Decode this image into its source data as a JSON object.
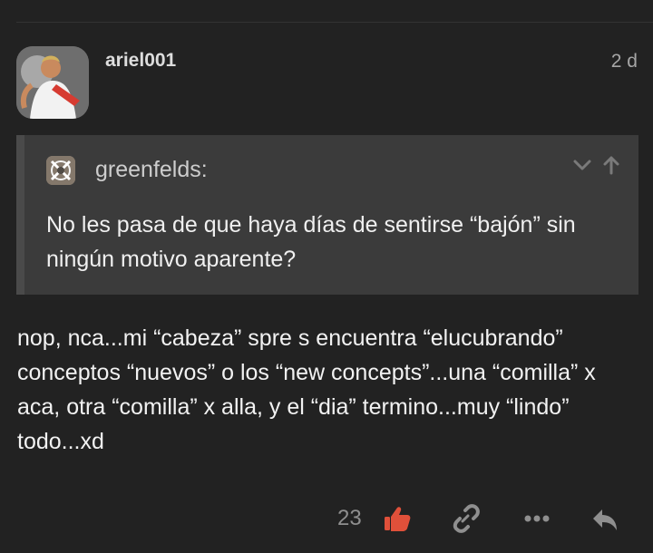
{
  "post": {
    "username": "ariel001",
    "date": "2 d",
    "avatar_icon": "user-avatar-photo",
    "quote": {
      "author": "greenfelds:",
      "avatar_icon": "quoted-user-avatar",
      "text": "No les pasa de que haya días de sentirse “bajón” sin ningún motivo aparente?",
      "controls": [
        "chevron-down-icon",
        "arrow-up-icon"
      ]
    },
    "body": "nop, nca...mi “cabeza” spre s encuentra “elucubrando” conceptos “nuevos” o los “new concepts”...una “comilla” x aca, otra “comilla” x alla, y el “dia” termino...muy “lindo” todo...xd",
    "actions": {
      "like_count": "23",
      "like_color": "#e0503a",
      "icons": [
        "thumbs-up-icon",
        "link-icon",
        "more-icon",
        "reply-icon"
      ]
    }
  }
}
